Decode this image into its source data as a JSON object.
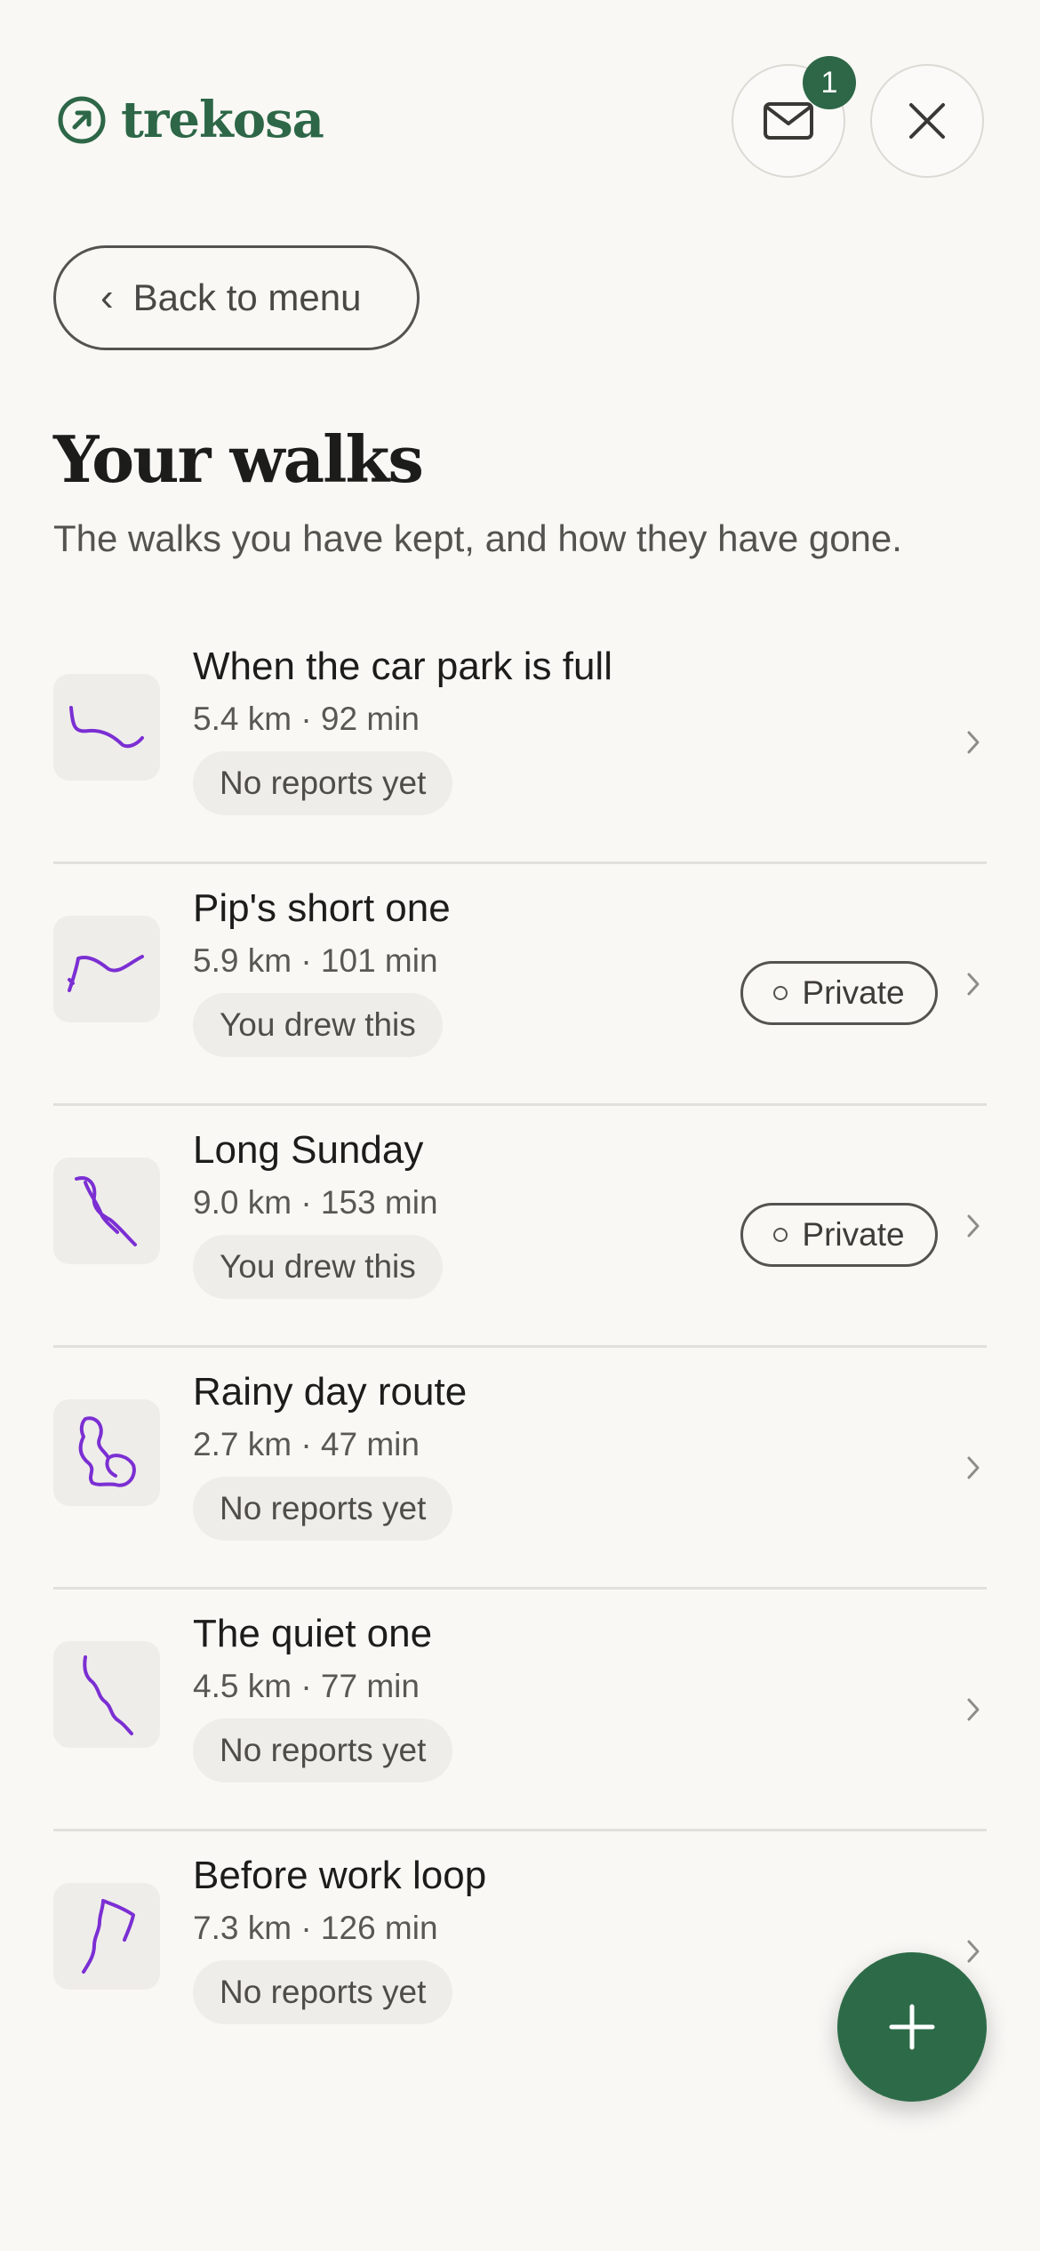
{
  "app": {
    "brand": "trekosa",
    "icon": "arrow-up-right-circle-icon",
    "accent_color": "#2d6747",
    "route_color": "#7b2fd3"
  },
  "header": {
    "unread_count": "1",
    "mail_icon": "mail-icon",
    "close_icon": "close-icon"
  },
  "nav": {
    "back_label": "Back to menu"
  },
  "page": {
    "title": "Your walks",
    "subtitle": "The walks you have kept, and how they have gone."
  },
  "walks": [
    {
      "name": "When the car park is full",
      "meta": "5.4 km · 92 min",
      "status": "No reports yet",
      "private": null
    },
    {
      "name": "Pip's short one",
      "meta": "5.9 km · 101 min",
      "status": "You drew this",
      "private": "Private"
    },
    {
      "name": "Long Sunday",
      "meta": "9.0 km · 153 min",
      "status": "You drew this",
      "private": "Private"
    },
    {
      "name": "Rainy day route",
      "meta": "2.7 km · 47 min",
      "status": "No reports yet",
      "private": null
    },
    {
      "name": "The quiet one",
      "meta": "4.5 km · 77 min",
      "status": "No reports yet",
      "private": null
    },
    {
      "name": "Before work loop",
      "meta": "7.3 km · 126 min",
      "status": "No reports yet",
      "private": null
    }
  ],
  "fab": {
    "icon": "plus-icon"
  }
}
